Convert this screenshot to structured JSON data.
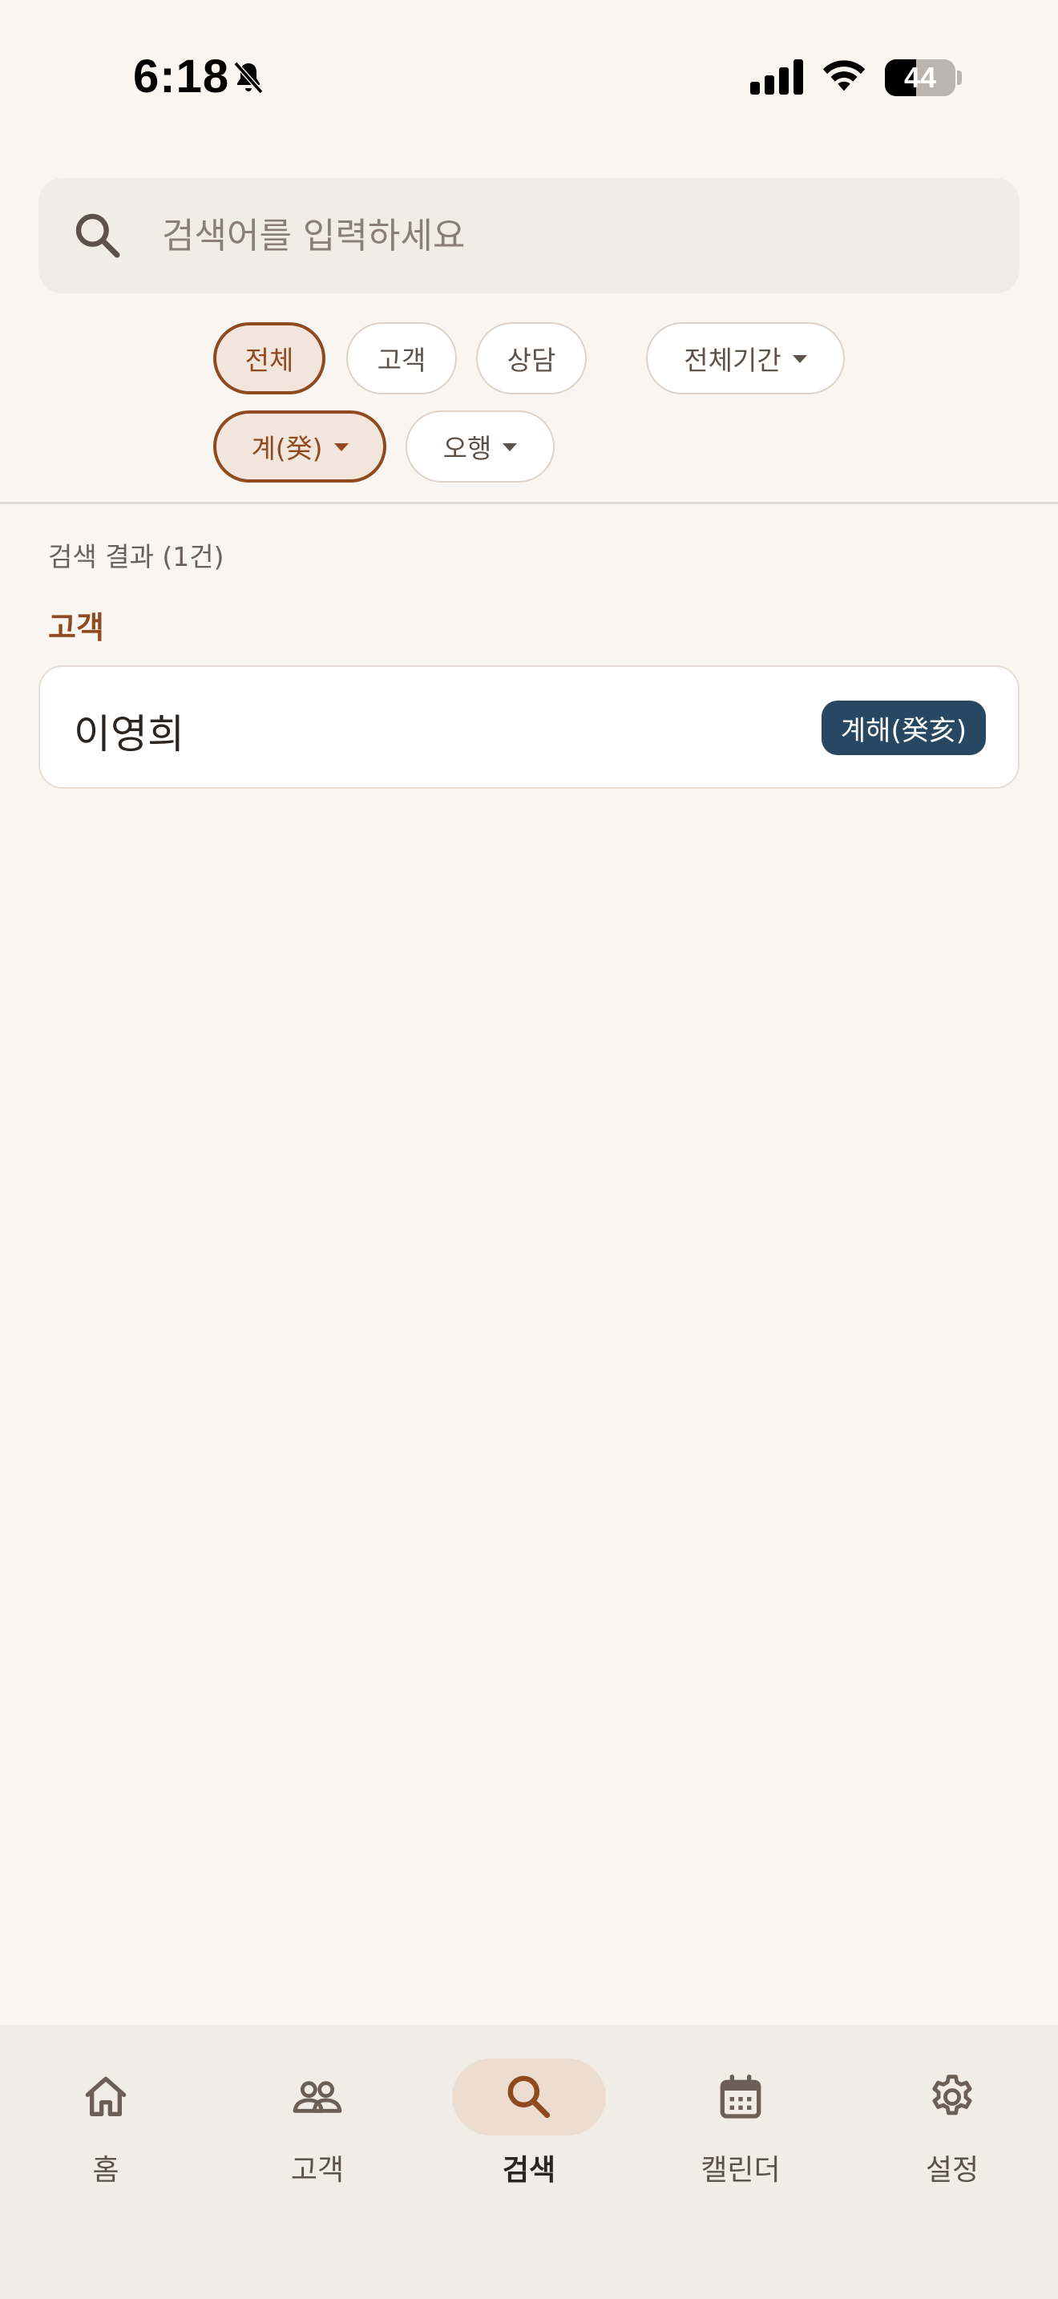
{
  "status_bar": {
    "time": "6:18",
    "battery_level": "44",
    "battery_fraction": 0.44
  },
  "search": {
    "placeholder": "검색어를 입력하세요",
    "value": ""
  },
  "filters": {
    "type_chips": [
      {
        "label": "전체",
        "selected": true
      },
      {
        "label": "고객",
        "selected": false
      },
      {
        "label": "상담",
        "selected": false
      }
    ],
    "period": {
      "label": "전체기간"
    },
    "heavenly_stem": {
      "label": "계(癸)",
      "selected": true
    },
    "five_elements": {
      "label": "오행",
      "selected": false
    }
  },
  "results": {
    "count_text": "검색 결과 (1건)",
    "section_title": "고객",
    "items": [
      {
        "name": "이영희",
        "badge": "계해(癸亥)"
      }
    ]
  },
  "nav": {
    "items": [
      {
        "label": "홈",
        "icon": "home-icon"
      },
      {
        "label": "고객",
        "icon": "people-icon"
      },
      {
        "label": "검색",
        "icon": "search-icon",
        "active": true
      },
      {
        "label": "캘린더",
        "icon": "calendar-icon"
      },
      {
        "label": "설정",
        "icon": "gear-icon"
      }
    ]
  },
  "colors": {
    "background": "#f9f6f2",
    "accent": "#8f4a1f",
    "badge": "#284763",
    "surface": "#f1ece6"
  }
}
